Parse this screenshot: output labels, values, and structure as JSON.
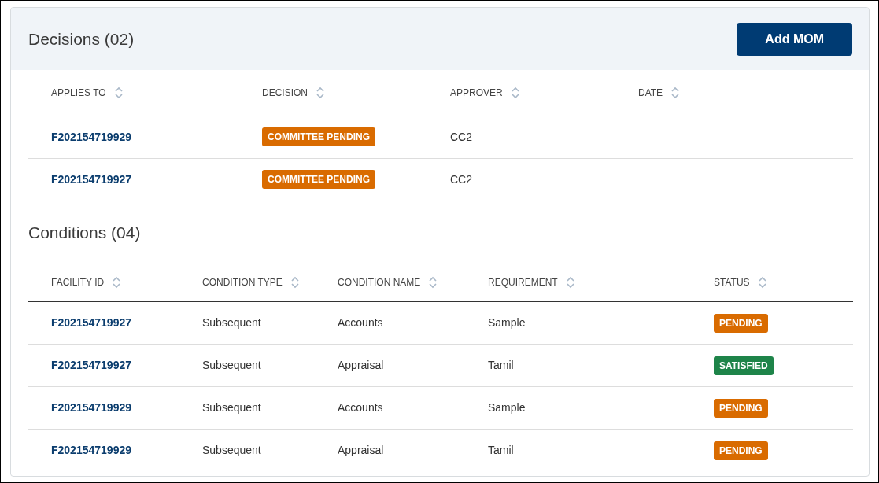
{
  "decisions": {
    "title": "Decisions (02)",
    "add_button": "Add MOM",
    "columns": [
      "APPLIES TO",
      "DECISION",
      "APPROVER",
      "DATE"
    ],
    "rows": [
      {
        "applies_to": "F202154719929",
        "decision": {
          "label": "COMMITTEE PENDING",
          "color": "#d96b00"
        },
        "approver": "CC2"
      },
      {
        "applies_to": "F202154719927",
        "decision": {
          "label": "COMMITTEE PENDING",
          "color": "#d96b00"
        },
        "approver": "CC2"
      }
    ]
  },
  "conditions": {
    "title": "Conditions (04)",
    "columns": [
      "FACILITY ID",
      "CONDITION TYPE",
      "CONDITION NAME",
      "REQUIREMENT",
      "STATUS"
    ],
    "rows": [
      {
        "facility_id": "F202154719927",
        "condition_type": "Subsequent",
        "condition_name": "Accounts",
        "requirement": "Sample",
        "status": {
          "label": "PENDING",
          "color": "#d96b00"
        }
      },
      {
        "facility_id": "F202154719927",
        "condition_type": "Subsequent",
        "condition_name": "Appraisal",
        "requirement": "Tamil",
        "status": {
          "label": "SATISFIED",
          "color": "#1e8449"
        }
      },
      {
        "facility_id": "F202154719929",
        "condition_type": "Subsequent",
        "condition_name": "Accounts",
        "requirement": "Sample",
        "status": {
          "label": "PENDING",
          "color": "#d96b00"
        }
      },
      {
        "facility_id": "F202154719929",
        "condition_type": "Subsequent",
        "condition_name": "Appraisal",
        "requirement": "Tamil",
        "status": {
          "label": "PENDING",
          "color": "#d96b00"
        }
      }
    ]
  }
}
